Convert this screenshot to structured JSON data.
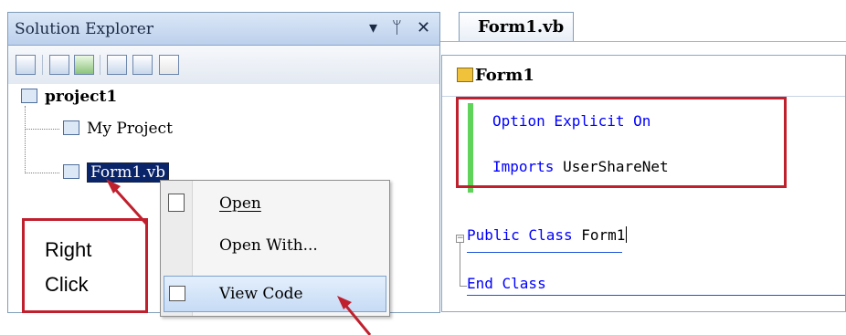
{
  "solution_explorer": {
    "title": "Solution Explorer",
    "pin_glyph": "▾ ⊥",
    "close_glyph": "✕",
    "toolbar_icons": [
      "properties-icon",
      "show-all-files-icon",
      "refresh-icon",
      "view-code-icon",
      "view-designer-icon",
      "class-diagram-icon"
    ],
    "tree": {
      "project": "project1",
      "my_project": "My Project",
      "form": "Form1.vb"
    }
  },
  "context_menu": {
    "items": [
      {
        "label": "Open",
        "icon": "open-icon"
      },
      {
        "label": "Open With...",
        "icon": ""
      },
      {
        "label": "View Code",
        "icon": "view-code-icon"
      }
    ]
  },
  "annotations": {
    "right_click_line1": "Right",
    "right_click_line2": "Click"
  },
  "editor": {
    "tab_label": "Form1.vb",
    "class_dropdown": "Form1",
    "lines": {
      "l1_kw": "Option Explicit On",
      "l2_kw": "Imports",
      "l2_id": " UserShareNet",
      "l3_kw": "Public Class",
      "l3_id": " Form1",
      "l4_kw": "End Class"
    }
  },
  "colors": {
    "keyword": "#0000ff",
    "highlight": "#c0202e",
    "changed_margin": "#5fd35a"
  }
}
